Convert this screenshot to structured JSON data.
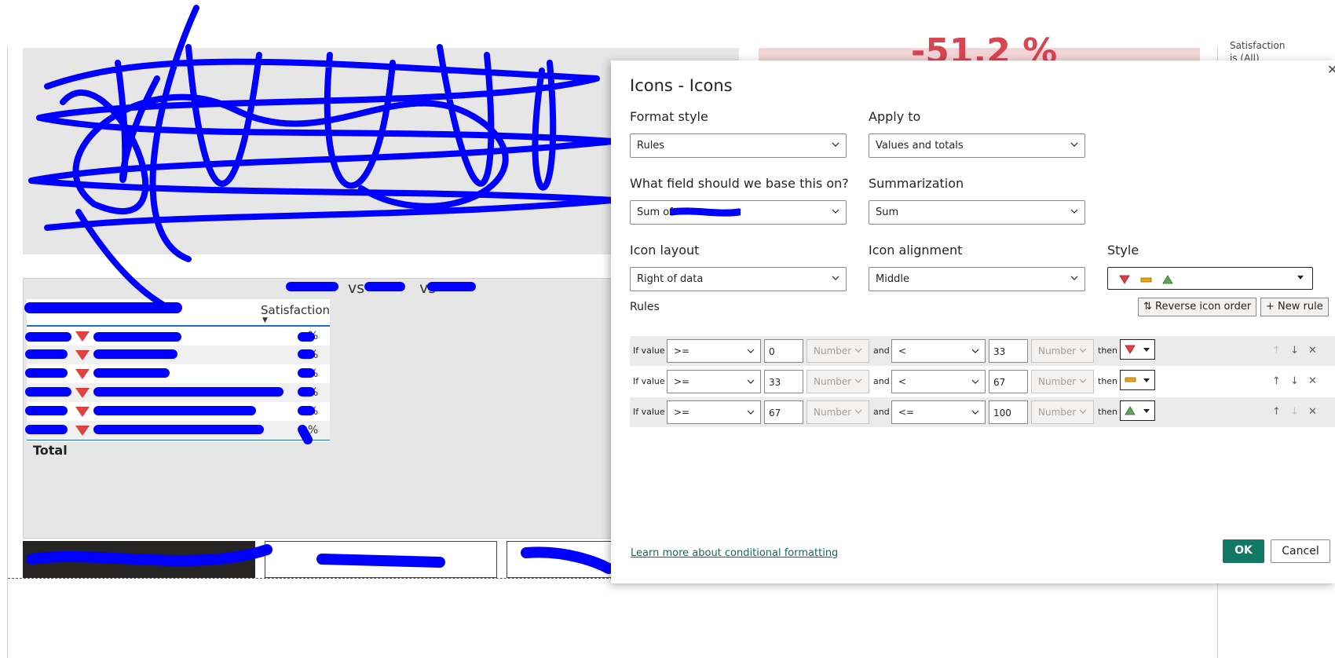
{
  "background": {
    "kpi_text": "-51.2 %",
    "filter_text_1": "Satisfaction",
    "filter_text_2": "is (All)",
    "table_title_vs1": "vs",
    "table_title_vs2": "vs",
    "column_header": "Satisfaction",
    "row_pct": [
      "%",
      "%",
      "%",
      "%",
      "%",
      "%"
    ],
    "total_label": "Total"
  },
  "dialog": {
    "title": "Icons - Icons",
    "close_glyph": "✕",
    "format_style": {
      "label": "Format style",
      "value": "Rules"
    },
    "apply_to": {
      "label": "Apply to",
      "value": "Values and totals"
    },
    "base_field": {
      "label": "What field should we base this on?",
      "value": "Sum of"
    },
    "summarization": {
      "label": "Summarization",
      "value": "Sum"
    },
    "icon_layout": {
      "label": "Icon layout",
      "value": "Right of data"
    },
    "icon_alignment": {
      "label": "Icon alignment",
      "value": "Middle"
    },
    "style": {
      "label": "Style"
    },
    "rules_label": "Rules",
    "reverse_order_label": "Reverse icon order",
    "new_rule_label": "New rule",
    "rules": [
      {
        "if": "If value",
        "op1": ">=",
        "v1": "0",
        "t1": "Number",
        "and": "and",
        "op2": "<",
        "v2": "33",
        "t2": "Number",
        "then": "then",
        "icon": "red-down-triangle"
      },
      {
        "if": "If value",
        "op1": ">=",
        "v1": "33",
        "t1": "Number",
        "and": "and",
        "op2": "<",
        "v2": "67",
        "t2": "Number",
        "then": "then",
        "icon": "yellow-bar"
      },
      {
        "if": "If value",
        "op1": ">=",
        "v1": "67",
        "t1": "Number",
        "and": "and",
        "op2": "<=",
        "v2": "100",
        "t2": "Number",
        "then": "then",
        "icon": "green-up-triangle"
      }
    ],
    "learn_more": "Learn more about conditional formatting",
    "ok_label": "OK",
    "cancel_label": "Cancel"
  },
  "colors": {
    "accent": "#117865",
    "red_icon": "#e04040",
    "yellow_icon": "#e8a317",
    "green_icon": "#5fa55a",
    "redaction": "#0000ff"
  }
}
